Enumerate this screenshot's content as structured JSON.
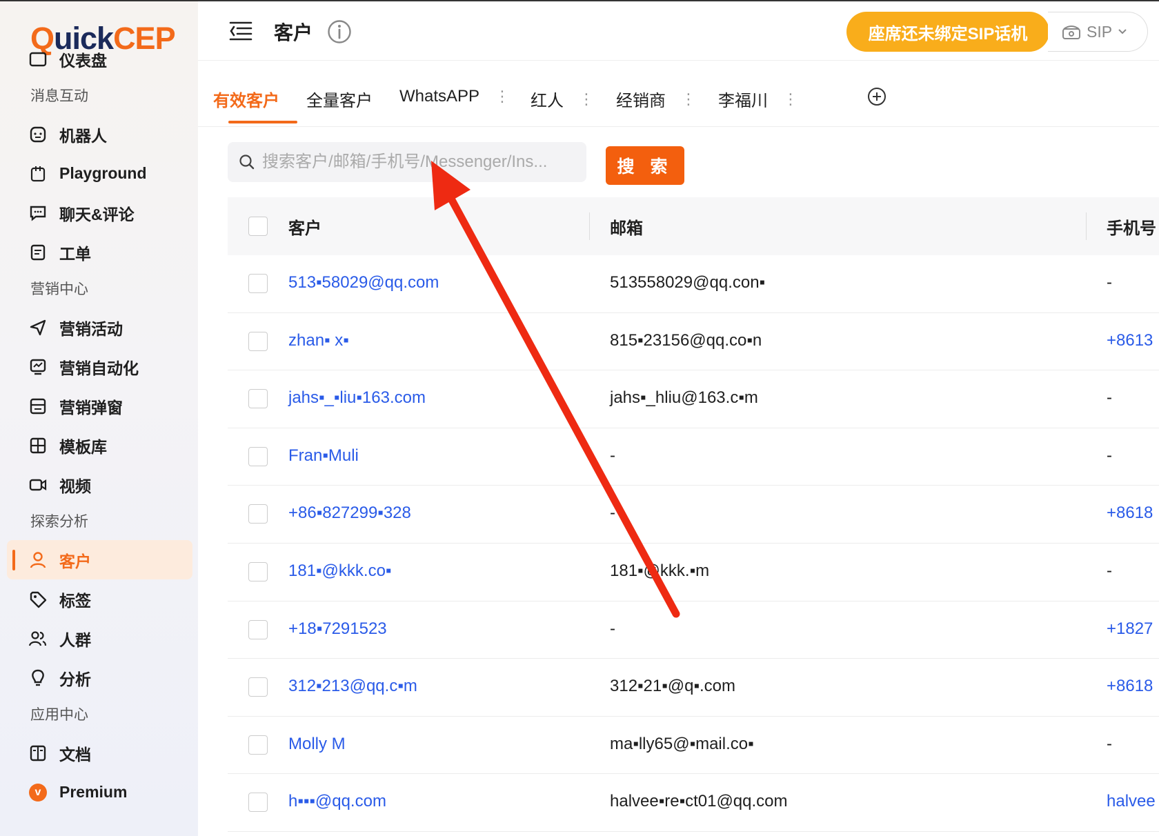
{
  "app": {
    "logo_q": "Q",
    "logo_u": "uick",
    "logo_cep": "CEP"
  },
  "sidebar": {
    "items": [
      {
        "type": "item",
        "label": "仪表盘",
        "icon": "dashboard-icon",
        "name": "sidebar-item-dashboard"
      },
      {
        "type": "section",
        "label": "消息互动",
        "name": "section-message"
      },
      {
        "type": "item",
        "label": "机器人",
        "icon": "robot-icon",
        "name": "sidebar-item-robot"
      },
      {
        "type": "item",
        "label": "Playground",
        "icon": "flask-icon",
        "name": "sidebar-item-playground"
      },
      {
        "type": "item",
        "label": "聊天&评论",
        "icon": "chat-icon",
        "name": "sidebar-item-chat"
      },
      {
        "type": "item",
        "label": "工单",
        "icon": "ticket-icon",
        "name": "sidebar-item-ticket"
      },
      {
        "type": "section",
        "label": "营销中心",
        "name": "section-marketing"
      },
      {
        "type": "item",
        "label": "营销活动",
        "icon": "send-icon",
        "name": "sidebar-item-campaign"
      },
      {
        "type": "item",
        "label": "营销自动化",
        "icon": "automation-icon",
        "name": "sidebar-item-automation"
      },
      {
        "type": "item",
        "label": "营销弹窗",
        "icon": "popup-icon",
        "name": "sidebar-item-popup"
      },
      {
        "type": "item",
        "label": "模板库",
        "icon": "template-icon",
        "name": "sidebar-item-templates"
      },
      {
        "type": "item",
        "label": "视频",
        "icon": "video-icon",
        "name": "sidebar-item-video"
      },
      {
        "type": "section",
        "label": "探索分析",
        "name": "section-analysis"
      },
      {
        "type": "item",
        "label": "客户",
        "icon": "user-icon",
        "name": "sidebar-item-customers",
        "active": true
      },
      {
        "type": "item",
        "label": "标签",
        "icon": "tag-icon",
        "name": "sidebar-item-tags"
      },
      {
        "type": "item",
        "label": "人群",
        "icon": "group-icon",
        "name": "sidebar-item-segments"
      },
      {
        "type": "item",
        "label": "分析",
        "icon": "bulb-icon",
        "name": "sidebar-item-analysis"
      },
      {
        "type": "section",
        "label": "应用中心",
        "name": "section-apps"
      },
      {
        "type": "item",
        "label": "文档",
        "icon": "docs-icon",
        "name": "sidebar-item-docs"
      },
      {
        "type": "item",
        "label": "Premium",
        "icon": "premium-icon",
        "name": "sidebar-item-premium"
      }
    ]
  },
  "header": {
    "title": "客户",
    "sip_button": "座席还未绑定SIP话机",
    "sip_select": "SIP"
  },
  "tabs": [
    {
      "label": "有效客户",
      "active": true,
      "menu": false
    },
    {
      "label": "全量客户",
      "active": false,
      "menu": false
    },
    {
      "label": "WhatsAPP",
      "active": false,
      "menu": true
    },
    {
      "label": "红人",
      "active": false,
      "menu": true
    },
    {
      "label": "经销商",
      "active": false,
      "menu": true
    },
    {
      "label": "李福川",
      "active": false,
      "menu": true
    }
  ],
  "search": {
    "placeholder": "搜索客户/邮箱/手机号/Messenger/Ins...",
    "button": "搜 索"
  },
  "table": {
    "headers": [
      "客户",
      "邮箱",
      "手机号"
    ],
    "rows": [
      {
        "customer": "513▪58029@qq.com",
        "email": "513558029@qq.con▪",
        "phone": "-"
      },
      {
        "customer": "zhan▪ x▪",
        "email": "815▪23156@qq.co▪n",
        "phone": "+8613"
      },
      {
        "customer": "jahs▪_▪liu▪163.com",
        "email": "jahs▪_hliu@163.c▪m",
        "phone": "-"
      },
      {
        "customer": "Fran▪Muli",
        "email": "-",
        "phone": "-"
      },
      {
        "customer": "+86▪827299▪328",
        "email": "-",
        "phone": "+8618"
      },
      {
        "customer": "181▪@kkk.co▪",
        "email": "181▪@kkk.▪m",
        "phone": "-"
      },
      {
        "customer": "+18▪7291523",
        "email": "-",
        "phone": "+1827"
      },
      {
        "customer": "312▪213@qq.c▪m",
        "email": "312▪21▪@q▪.com",
        "phone": "+8618"
      },
      {
        "customer": "Molly M",
        "email": "ma▪lly65@▪mail.co▪",
        "phone": "-"
      },
      {
        "customer": "h▪▪▪@qq.com",
        "email": "halvee▪re▪ct01@qq.com",
        "phone": "halvee"
      }
    ]
  },
  "colors": {
    "accent": "#f36a1a",
    "link": "#2a5be8",
    "sip": "#f9ad1b",
    "annotation_arrow": "#ee2a12"
  }
}
